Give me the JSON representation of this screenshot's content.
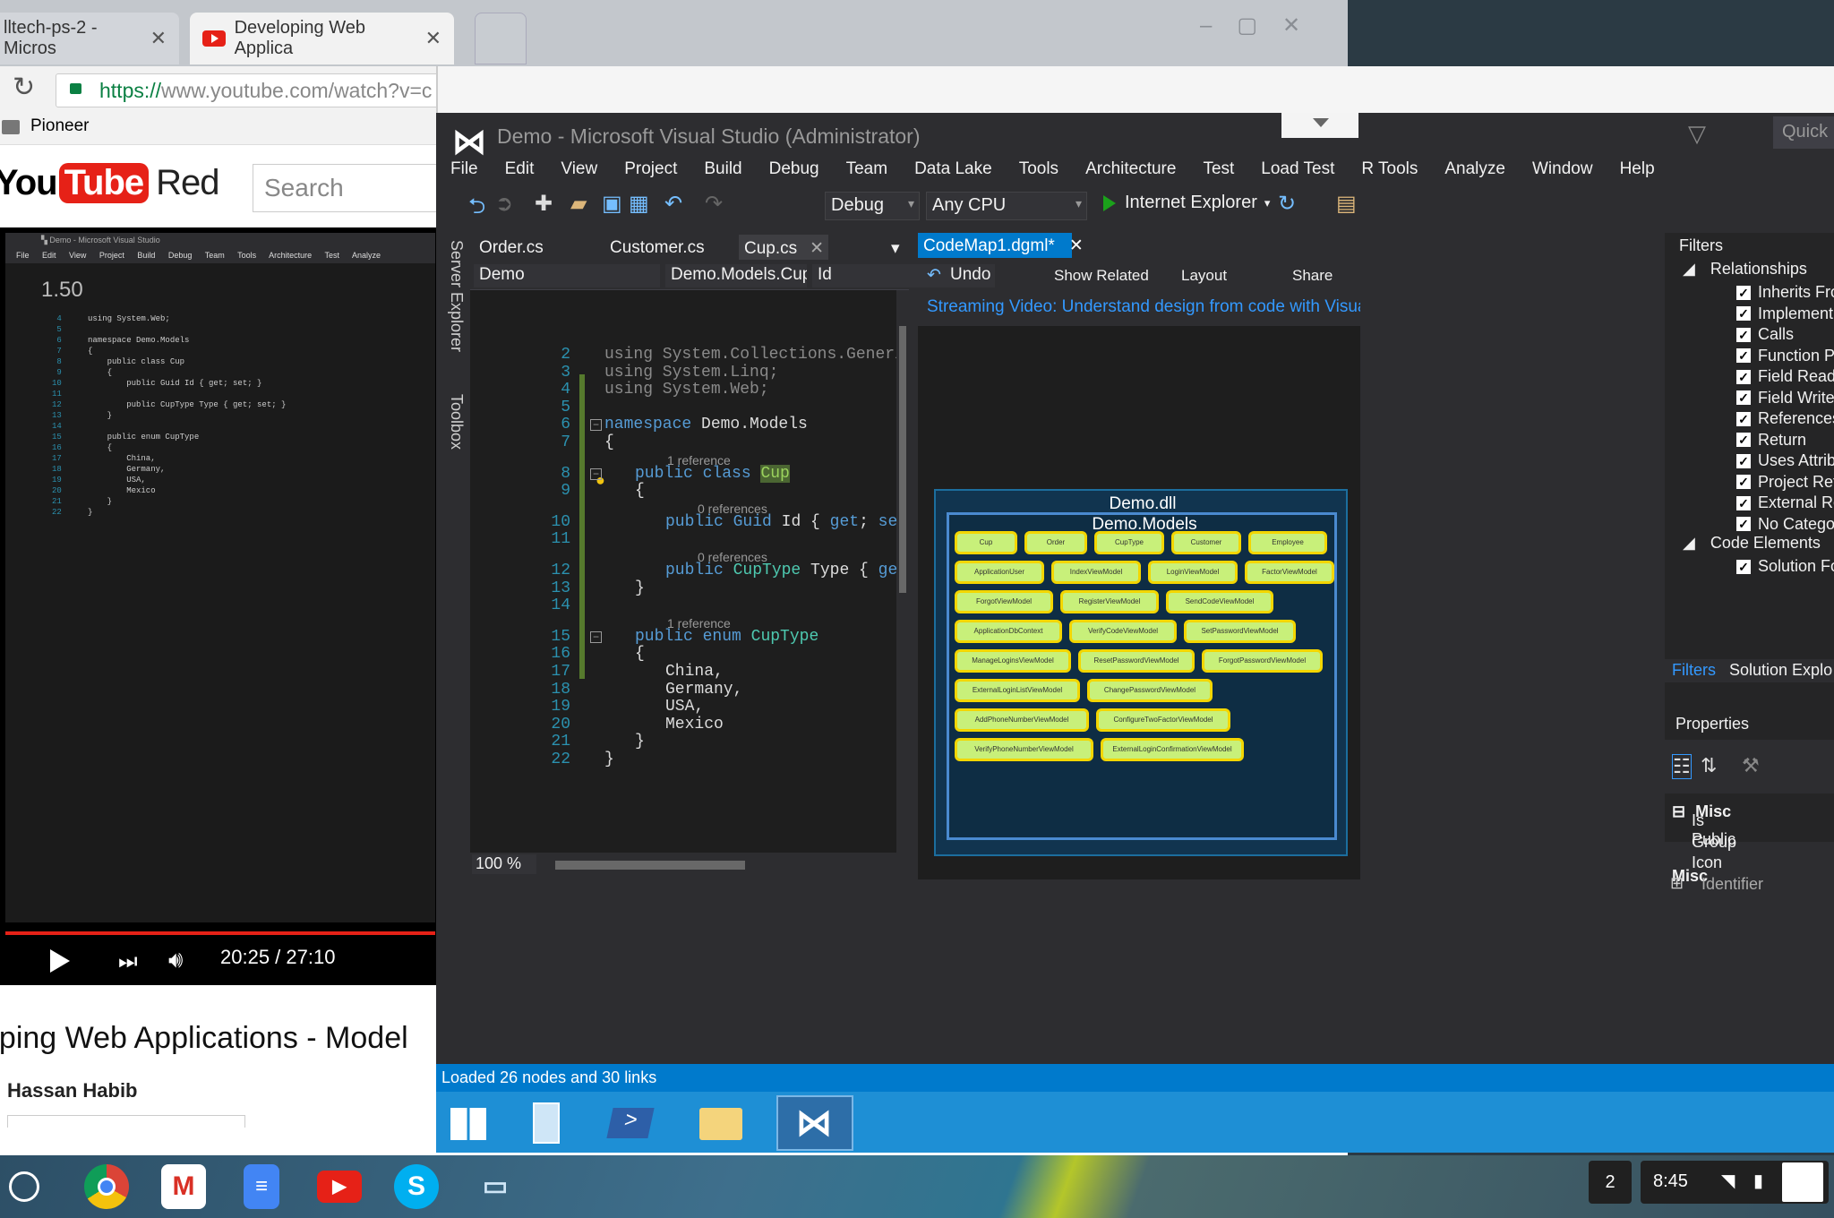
{
  "chrome": {
    "tabs": [
      {
        "label": "lltech-ps-2 - Micros"
      },
      {
        "label": "Developing Web Applica"
      }
    ],
    "url_https": "https://",
    "url_rest": "www.youtube.com/watch?v=c",
    "bookmark": "Pioneer",
    "search_placeholder": "Search",
    "logo_you": "You",
    "logo_tube": "Tube",
    "logo_red": "Red",
    "player_zoom": "1.50",
    "time": "20:25 / 27:10",
    "video_title": "oping Web Applications - Model",
    "author": "Hassan Habib"
  },
  "vs": {
    "title": "Demo - Microsoft Visual Studio (Administrator)",
    "quick_launch": "Quick L",
    "menu": [
      "File",
      "Edit",
      "View",
      "Project",
      "Build",
      "Debug",
      "Team",
      "Data Lake",
      "Tools",
      "Architecture",
      "Test",
      "Load Test",
      "R Tools",
      "Analyze",
      "Window",
      "Help"
    ],
    "config": "Debug",
    "platform": "Any CPU",
    "run_target": "Internet Explorer",
    "side_tabs": [
      "Server Explorer",
      "Toolbox"
    ],
    "doc_tabs": [
      "Order.cs",
      "Customer.cs",
      "Cup.cs"
    ],
    "nav": {
      "project": "Demo",
      "class": "Demo.Models.Cup",
      "member": "Id"
    },
    "zoom": "100 %",
    "codemap": {
      "tab": "CodeMap1.dgml*",
      "undo": "Undo",
      "show_related": "Show Related",
      "layout": "Layout",
      "share": "Share",
      "banner": "Streaming Video: Understand design from code with Visual Studio co",
      "dll": "Demo.dll",
      "namespace": "Demo.Models",
      "nodes": [
        "Cup",
        "Order",
        "CupType",
        "Customer",
        "Employee",
        "ApplicationUser",
        "IndexViewModel",
        "LoginViewModel",
        "FactorViewModel",
        "ForgotViewModel",
        "RegisterViewModel",
        "SendCodeViewModel",
        "ApplicationDbContext",
        "VerifyCodeViewModel",
        "SetPasswordViewModel",
        "ManageLoginsViewModel",
        "ResetPasswordViewModel",
        "ForgotPasswordViewModel",
        "ExternalLoginListViewModel",
        "ChangePasswordViewModel",
        "AddPhoneNumberViewModel",
        "ConfigureTwoFactorViewModel",
        "VerifyPhoneNumberViewModel",
        "ExternalLoginConfirmationViewModel"
      ]
    },
    "filters": {
      "title": "Filters",
      "relationships": "Relationships",
      "items": [
        "Inherits Fro",
        "Implement",
        "Calls",
        "Function Po",
        "Field Read",
        "Field Write",
        "References",
        "Return",
        "Uses Attribu",
        "Project Refe",
        "External Ref",
        "No Categor"
      ],
      "code_elements": "Code Elements",
      "solution_fo": "Solution Fo",
      "tab_filters": "Filters",
      "tab_solution": "Solution Explo"
    },
    "properties": {
      "title": "Properties",
      "group": "Misc",
      "rows": [
        "Is Public",
        "Group",
        "Icon",
        "Identifier"
      ],
      "footer": "Misc"
    },
    "status": "Loaded 26 nodes and 30 links"
  },
  "code": {
    "lines": [
      {
        "n": "2",
        "t": "using System.Collections.Generic;"
      },
      {
        "n": "3",
        "t": "using System.Linq;"
      },
      {
        "n": "4",
        "t": "using System.Web;"
      },
      {
        "n": "5",
        "t": ""
      },
      {
        "n": "6",
        "t": "namespace Demo.Models"
      },
      {
        "n": "7",
        "t": "{"
      },
      {
        "n": "8",
        "t": "public class Cup"
      },
      {
        "n": "9",
        "t": "{"
      },
      {
        "n": "10",
        "t": "public Guid Id { get; set; }"
      },
      {
        "n": "11",
        "t": ""
      },
      {
        "n": "12",
        "t": "public CupType Type { get; set; }"
      },
      {
        "n": "13",
        "t": "}"
      },
      {
        "n": "14",
        "t": ""
      },
      {
        "n": "15",
        "t": "public enum CupType"
      },
      {
        "n": "16",
        "t": "{"
      },
      {
        "n": "17",
        "t": "China,"
      },
      {
        "n": "18",
        "t": "Germany,"
      },
      {
        "n": "19",
        "t": "USA,"
      },
      {
        "n": "20",
        "t": "Mexico"
      },
      {
        "n": "21",
        "t": "}"
      },
      {
        "n": "22",
        "t": "}"
      }
    ],
    "lens": [
      "1 reference",
      "0 references",
      "0 references",
      "1 reference"
    ]
  },
  "shelf": {
    "notifications": "2",
    "clock": "8:45"
  },
  "colors": {
    "vs_bg": "#2d2d30",
    "editor_bg": "#1e1e1e",
    "accent": "#007acc",
    "node_fill": "#c8f07a",
    "node_border": "#f3d600"
  }
}
